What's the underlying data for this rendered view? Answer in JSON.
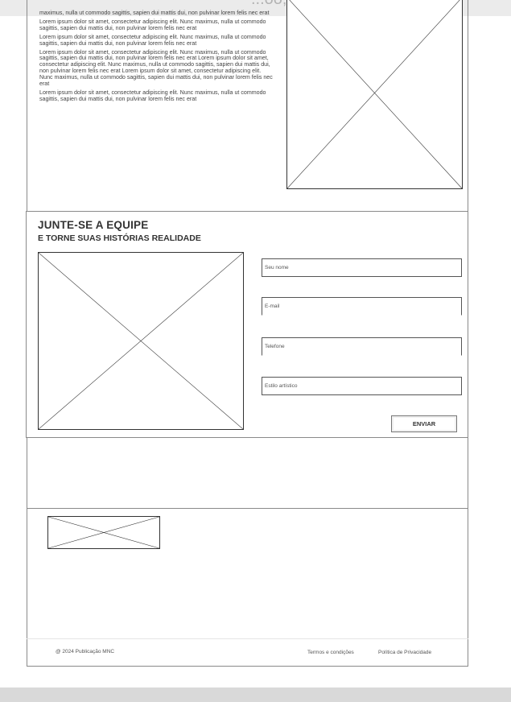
{
  "header": {
    "partial_text": "...oo, lago"
  },
  "intro": {
    "first_fragment": "maximus, nulla ut commodo sagittis, sapien dui mattis dui, non pulvinar lorem felis nec erat",
    "paragraphs": [
      "Lorem ipsum dolor sit amet, consectetur adipiscing elit. Nunc maximus, nulla ut commodo sagittis, sapien dui mattis dui, non pulvinar lorem felis nec erat",
      "Lorem ipsum dolor sit amet, consectetur adipiscing elit. Nunc maximus, nulla ut commodo sagittis, sapien dui mattis dui, non pulvinar lorem felis nec erat",
      "Lorem ipsum dolor sit amet, consectetur adipiscing elit. Nunc maximus, nulla ut commodo sagittis, sapien dui mattis dui, non pulvinar lorem felis nec erat Lorem ipsum dolor sit amet, consectetur adipiscing elit. Nunc maximus, nulla ut commodo sagittis, sapien dui mattis dui, non pulvinar lorem felis nec erat Lorem ipsum dolor sit amet, consectetur adipiscing elit. Nunc maximus, nulla ut commodo sagittis, sapien dui mattis dui, non pulvinar lorem felis nec erat",
      "Lorem ipsum dolor sit amet, consectetur adipiscing elit. Nunc maximus, nulla ut commodo sagittis, sapien dui mattis dui, non pulvinar lorem felis nec erat"
    ]
  },
  "join": {
    "title": "JUNTE-SE A EQUIPE",
    "subtitle": "E TORNE SUAS HISTÓRIAS REALIDADE",
    "fields": {
      "name": "Seu nome",
      "email": "E-mail",
      "phone": "Telefone",
      "style": "Estilo artístico"
    },
    "submit_label": "ENVIAR"
  },
  "footer": {
    "copyright": "@ 2024 Publicação MNC",
    "terms": "Termos e condições",
    "privacy": "Política de Privacidade"
  }
}
